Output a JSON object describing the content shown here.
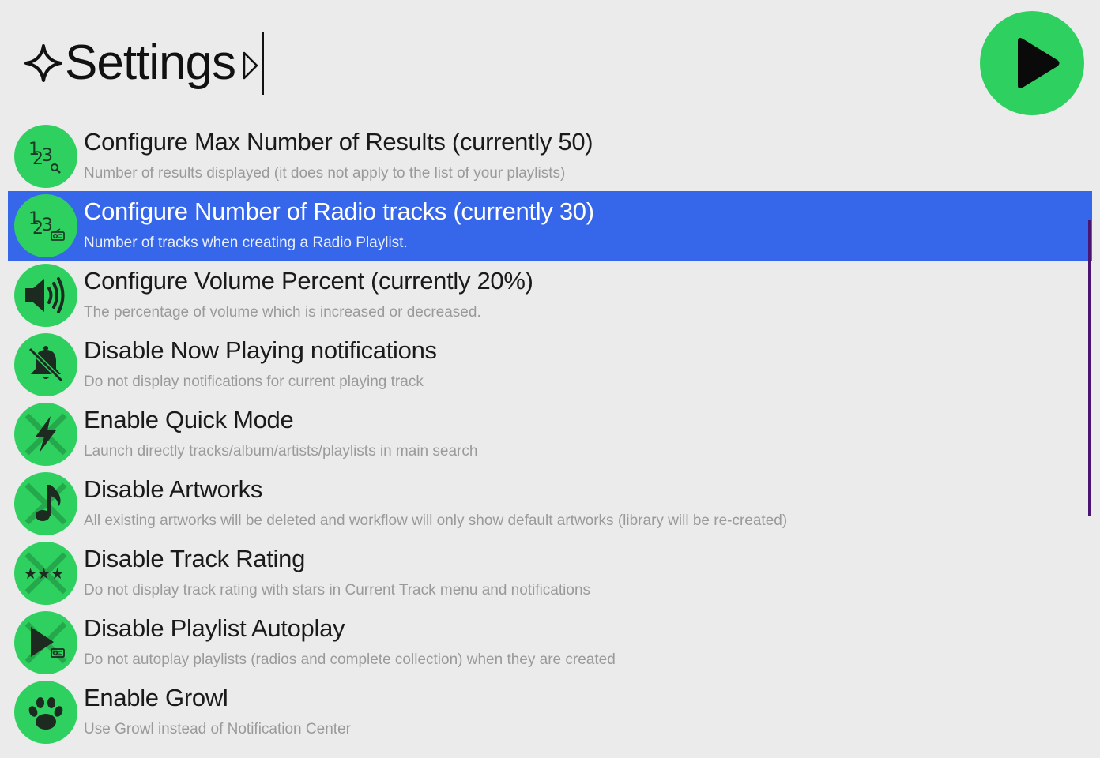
{
  "search": {
    "query": "Settings"
  },
  "colors": {
    "accent_green": "#2ed160",
    "selection_blue": "#3666ea",
    "background": "#ebebeb",
    "scrollbar": "#4a1572"
  },
  "results": [
    {
      "icon": "number-search-icon",
      "title": "Configure Max Number of Results (currently 50)",
      "subtitle": "Number of results displayed (it does not apply to the list of your playlists)"
    },
    {
      "icon": "number-radio-icon",
      "title": "Configure Number of Radio tracks (currently 30)",
      "subtitle": "Number of tracks when creating a Radio Playlist.",
      "selected": true
    },
    {
      "icon": "speaker-volume-icon",
      "title": "Configure Volume Percent (currently 20%)",
      "subtitle": "The percentage of volume which is increased or decreased."
    },
    {
      "icon": "bell-off-icon",
      "title": "Disable Now Playing notifications",
      "subtitle": "Do not display notifications for current playing track"
    },
    {
      "icon": "lightning-icon",
      "title": "Enable Quick Mode",
      "subtitle": "Launch directly tracks/album/artists/playlists in main search"
    },
    {
      "icon": "music-note-off-icon",
      "title": "Disable Artworks",
      "subtitle": "All existing artworks will be deleted and workflow will only show default artworks (library will be re-created)"
    },
    {
      "icon": "stars-off-icon",
      "title": "Disable Track Rating",
      "subtitle": "Do not display track rating with stars in Current Track menu and notifications"
    },
    {
      "icon": "play-radio-off-icon",
      "title": "Disable Playlist Autoplay",
      "subtitle": "Do not autoplay playlists (radios and complete collection) when they are created"
    },
    {
      "icon": "paw-icon",
      "title": "Enable Growl",
      "subtitle": "Use Growl instead of Notification Center"
    }
  ]
}
